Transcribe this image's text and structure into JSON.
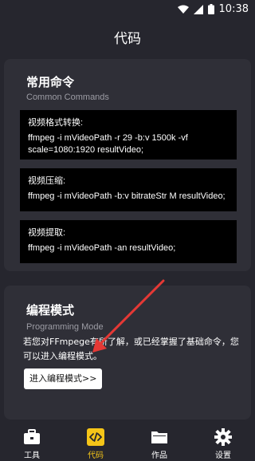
{
  "status_bar": {
    "time": "10:38"
  },
  "app_bar": {
    "title": "代码"
  },
  "common": {
    "title": "常用命令",
    "subtitle": "Common Commands",
    "commands": [
      {
        "label": "视频格式转换:",
        "code": "ffmpeg -i  mVideoPath -r 29 -b:v 1500k -vf scale=1080:1920 resultVideo;"
      },
      {
        "label": "视频压缩:",
        "code": "ffmpeg -i mVideoPath -b:v bitrateStr M resultVideo;"
      },
      {
        "label": "视频提取:",
        "code": "ffmpeg -i mVideoPath  -an resultVideo;"
      }
    ]
  },
  "programming": {
    "title": "编程模式",
    "subtitle": "Programming Mode",
    "description": "若您对FFmpege有所了解，或已经掌握了基础命令，您可以进入编程模式。",
    "button_label": "进入编程模式>>"
  },
  "nav": [
    {
      "label": "工具",
      "icon": "toolbox-icon"
    },
    {
      "label": "代码",
      "icon": "code-icon",
      "active": true
    },
    {
      "label": "作品",
      "icon": "folder-icon"
    },
    {
      "label": "设置",
      "icon": "gear-icon"
    }
  ],
  "colors": {
    "accent": "#f5c518",
    "background": "#26262e",
    "card": "#2f2f37",
    "arrow": "#e53935"
  }
}
